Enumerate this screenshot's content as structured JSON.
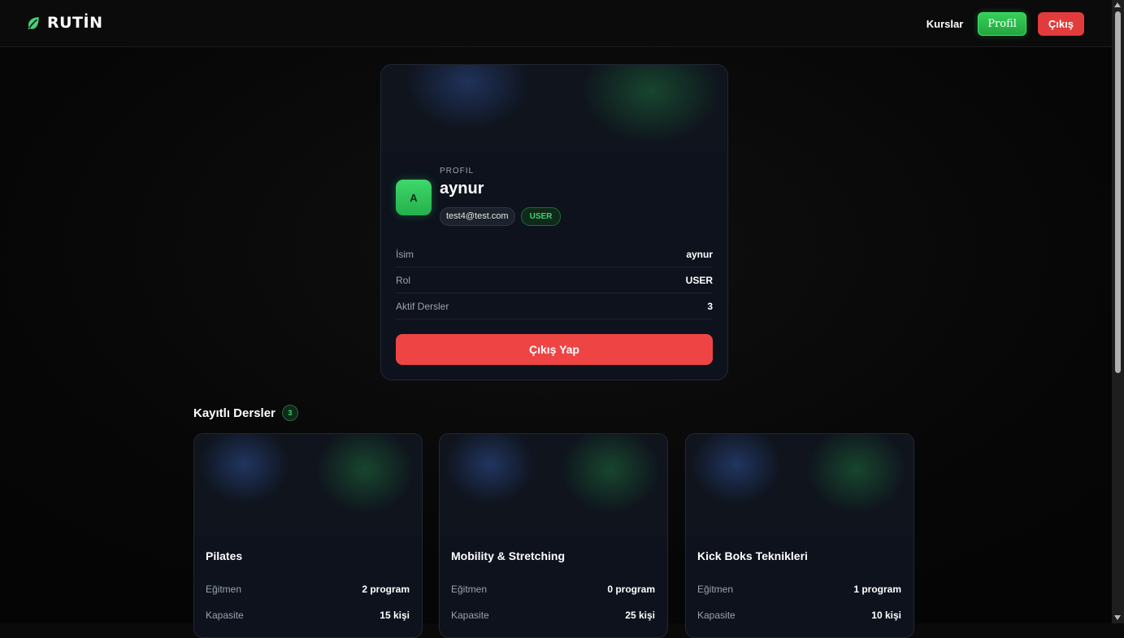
{
  "app": {
    "brand": "RUTİN",
    "brand_icon": "leaf-icon"
  },
  "nav": {
    "courses_link": "Kurslar",
    "profile_button": "Profil",
    "logout_button": "Çıkış"
  },
  "profile": {
    "eyebrow": "PROFIL",
    "avatar_letter": "A",
    "name": "aynur",
    "email": "test4@test.com",
    "role_chip": "USER",
    "rows": [
      {
        "label": "İsim",
        "value": "aynur"
      },
      {
        "label": "Rol",
        "value": "USER"
      },
      {
        "label": "Aktif Dersler",
        "value": "3"
      }
    ],
    "logout_button": "Çıkış Yap"
  },
  "courses": {
    "title": "Kayıtlı Dersler",
    "count": "3",
    "items": [
      {
        "name": "Pilates",
        "instructor_label": "Eğitmen",
        "instructor_value": "2 program",
        "capacity_label": "Kapasite",
        "capacity_value": "15 kişi"
      },
      {
        "name": "Mobility & Stretching",
        "instructor_label": "Eğitmen",
        "instructor_value": "0 program",
        "capacity_label": "Kapasite",
        "capacity_value": "25 kişi"
      },
      {
        "name": "Kick Boks Teknikleri",
        "instructor_label": "Eğitmen",
        "instructor_value": "1 program",
        "capacity_label": "Kapasite",
        "capacity_value": "10 kişi"
      }
    ]
  },
  "colors": {
    "accent_green": "#3ed46a",
    "danger_red": "#ef4444",
    "background": "#0a0a0a",
    "card": "#0d121c"
  }
}
